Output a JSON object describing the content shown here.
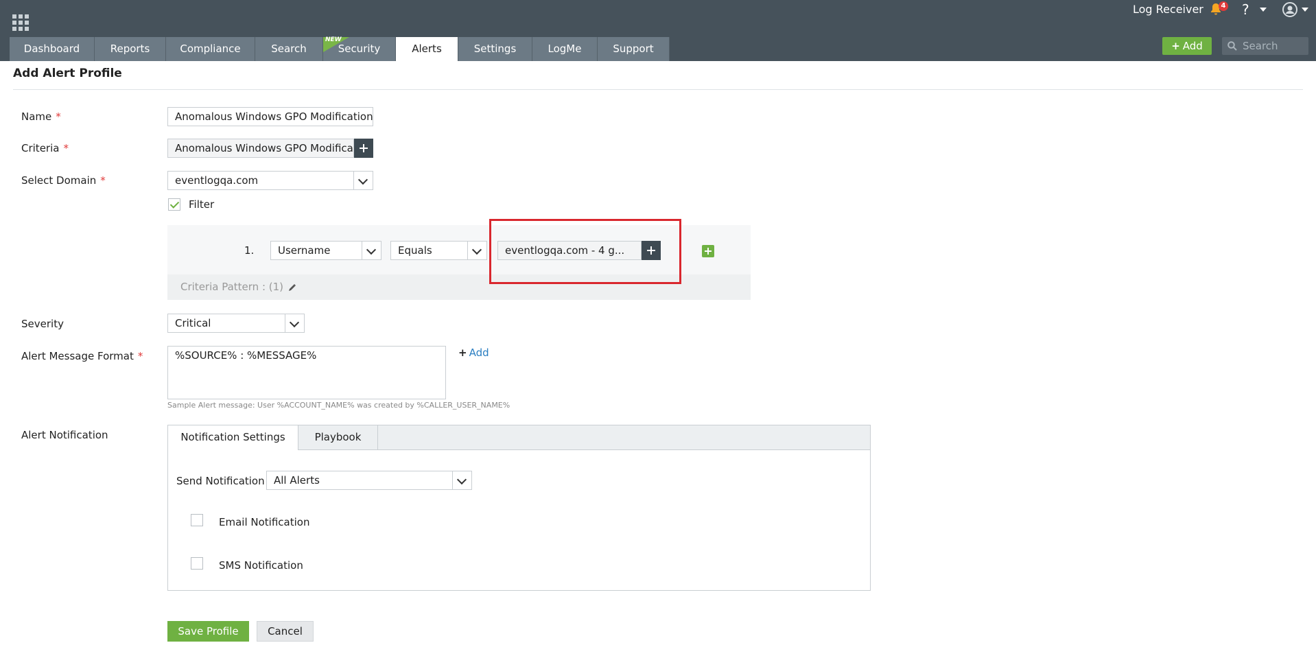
{
  "header": {
    "receiver_label": "Log Receiver",
    "notification_count": "4",
    "help_label": "?",
    "add_label": "Add",
    "search_placeholder": "Search",
    "tabs": [
      {
        "label": "Dashboard"
      },
      {
        "label": "Reports"
      },
      {
        "label": "Compliance"
      },
      {
        "label": "Search"
      },
      {
        "label": "Security",
        "badge": "NEW"
      },
      {
        "label": "Alerts",
        "active": true
      },
      {
        "label": "Settings"
      },
      {
        "label": "LogMe"
      },
      {
        "label": "Support"
      }
    ]
  },
  "page": {
    "title": "Add Alert Profile"
  },
  "form": {
    "name_label": "Name",
    "name_value": "Anomalous Windows GPO Modification",
    "criteria_label": "Criteria",
    "criteria_value": "Anomalous Windows GPO Modification",
    "domain_label": "Select Domain",
    "domain_value": "eventlogqa.com",
    "filter_label": "Filter",
    "filter_checked": true,
    "filter_rows": [
      {
        "index": "1.",
        "field": "Username",
        "operator": "Equals",
        "value": "eventlogqa.com - 4 g..."
      }
    ],
    "criteria_pattern": "Criteria Pattern : (1)",
    "severity_label": "Severity",
    "severity_value": "Critical",
    "message_label": "Alert Message Format",
    "message_value": "%SOURCE% : %MESSAGE%",
    "message_add": "Add",
    "sample_message": "Sample Alert message: User %ACCOUNT_NAME% was created by %CALLER_USER_NAME%",
    "notification_label": "Alert Notification",
    "required_mark": "*"
  },
  "notification": {
    "tabs": [
      "Notification Settings",
      "Playbook"
    ],
    "send_label": "Send Notification",
    "send_value": "All Alerts",
    "email_label": "Email Notification",
    "sms_label": "SMS Notification"
  },
  "actions": {
    "save_label": "Save Profile",
    "cancel_label": "Cancel"
  },
  "colors": {
    "topbar": "#46525b",
    "tab": "#6c7a85",
    "accent_green": "#6fb142",
    "required_red": "#e03a3a",
    "highlight_red": "#d9272e"
  }
}
